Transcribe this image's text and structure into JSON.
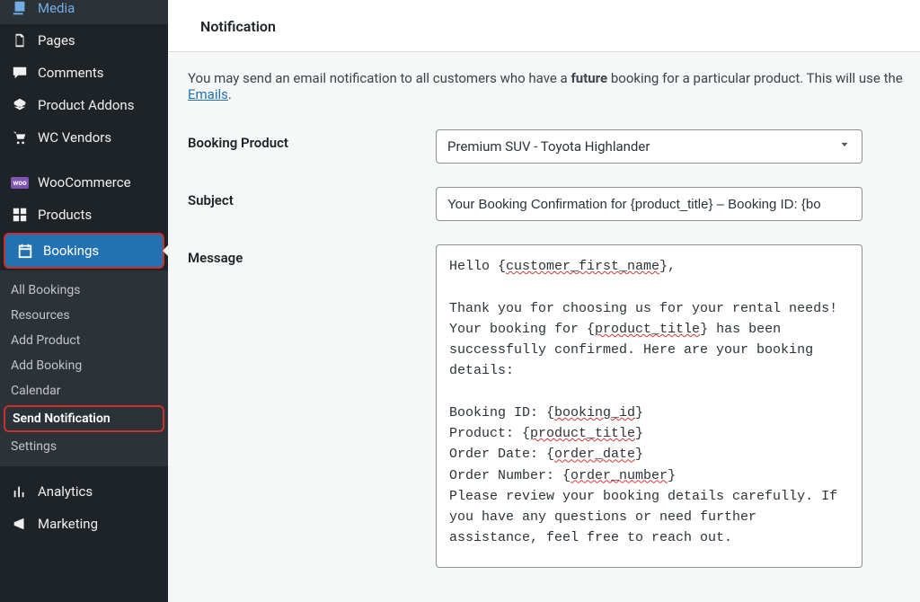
{
  "sidebar": {
    "items": {
      "media": "Media",
      "pages": "Pages",
      "comments": "Comments",
      "product_addons": "Product Addons",
      "wc_vendors": "WC Vendors",
      "woocommerce": "WooCommerce",
      "products": "Products",
      "bookings": "Bookings",
      "analytics": "Analytics",
      "marketing": "Marketing"
    },
    "submenu": {
      "all_bookings": "All Bookings",
      "resources": "Resources",
      "add_product": "Add Product",
      "add_booking": "Add Booking",
      "calendar": "Calendar",
      "send_notification": "Send Notification",
      "settings": "Settings"
    }
  },
  "page": {
    "title": "Notification",
    "intro_before": "You may send an email notification to all customers who have a ",
    "intro_bold": "future",
    "intro_after": " booking for a particular product. This will use the",
    "emails_link": "Emails"
  },
  "form": {
    "booking_product_label": "Booking Product",
    "booking_product_value": "Premium SUV - Toyota Highlander",
    "subject_label": "Subject",
    "subject_value": "Your Booking Confirmation for {product_title} – Booking ID: {bo",
    "message_label": "Message",
    "message": {
      "l1a": "Hello {",
      "l1b": "customer_first_name",
      "l1c": "},",
      "l2": "Thank you for choosing us for your rental needs!",
      "l3a": "Your booking for {",
      "l3b": "product_title",
      "l3c": "} has been",
      "l4": "successfully confirmed. Here are your booking",
      "l5": "details:",
      "l6a": "Booking ID: {",
      "l6b": "booking_id",
      "l6c": "}",
      "l7a": "Product: {",
      "l7b": "product_title",
      "l7c": "}",
      "l8a": "Order Date: {",
      "l8b": "order_date",
      "l8c": "}",
      "l9a": "Order Number: {",
      "l9b": "order_number",
      "l9c": "}",
      "l10": "Please review your booking details carefully. If",
      "l11": "you have any questions or need further",
      "l12": "assistance, feel free to reach out."
    }
  }
}
